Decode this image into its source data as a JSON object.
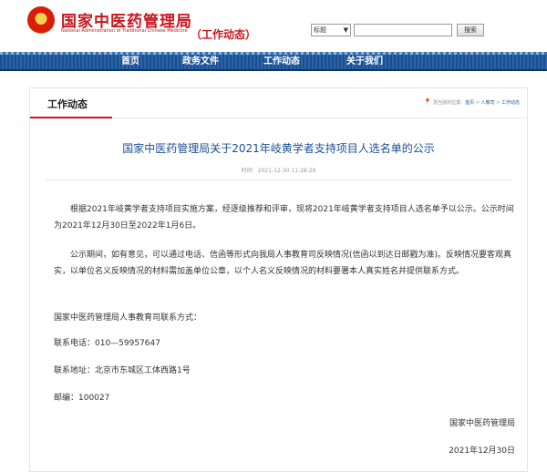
{
  "header": {
    "site_name": "国家中医药管理局",
    "site_name_en": "National Administration of Traditional Chinese Medicine",
    "section_tag": "（工作动态）",
    "search": {
      "select_value": "标题",
      "input_value": "",
      "button_label": "搜索"
    }
  },
  "nav": {
    "items": [
      {
        "label": "首页"
      },
      {
        "label": "政务文件"
      },
      {
        "label": "工作动态"
      },
      {
        "label": "关于我们"
      }
    ]
  },
  "panel": {
    "title": "工作动态",
    "breadcrumb": {
      "prefix": "您当前的位置：",
      "home": "首页",
      "sep1": " > ",
      "level1": "人教司",
      "sep2": " > ",
      "level2": "工作动态"
    }
  },
  "article": {
    "title": "国家中医药管理局关于2021年岐黄学者支持项目人选名单的公示",
    "time_label": "时间：",
    "time_value": "2021-12-30 11:28:29",
    "paragraphs": [
      "根据2021年岐黄学者支持项目实施方案，经逐级推荐和评审，现将2021年岐黄学者支持项目人选名单予以公示。公示时间为2021年12月30日至2022年1月6日。",
      "公示期间，如有意见，可以通过电话、信函等形式向我局人事教育司反映情况(信函以到达日邮戳为准)。反映情况要客观真实，以单位名义反映情况的材料需加盖单位公章，以个人名义反映情况的材料要署本人真实姓名并提供联系方式。"
    ],
    "contact_title": "国家中医药管理局人事教育司联系方式：",
    "phone": "联系电话：010—59957647",
    "address": "联系地址：北京市东城区工体西路1号",
    "postcode": "邮编：100027",
    "signature": "国家中医药管理局",
    "date": "2021年12月30日"
  },
  "colors": {
    "brand_red": "#c8161d",
    "nav_blue": "#1d4f8f",
    "title_blue": "#1b4f93"
  },
  "icons": {
    "emblem": "national-emblem-icon",
    "location": "location-pin-icon",
    "dropdown": "chevron-down-icon"
  }
}
